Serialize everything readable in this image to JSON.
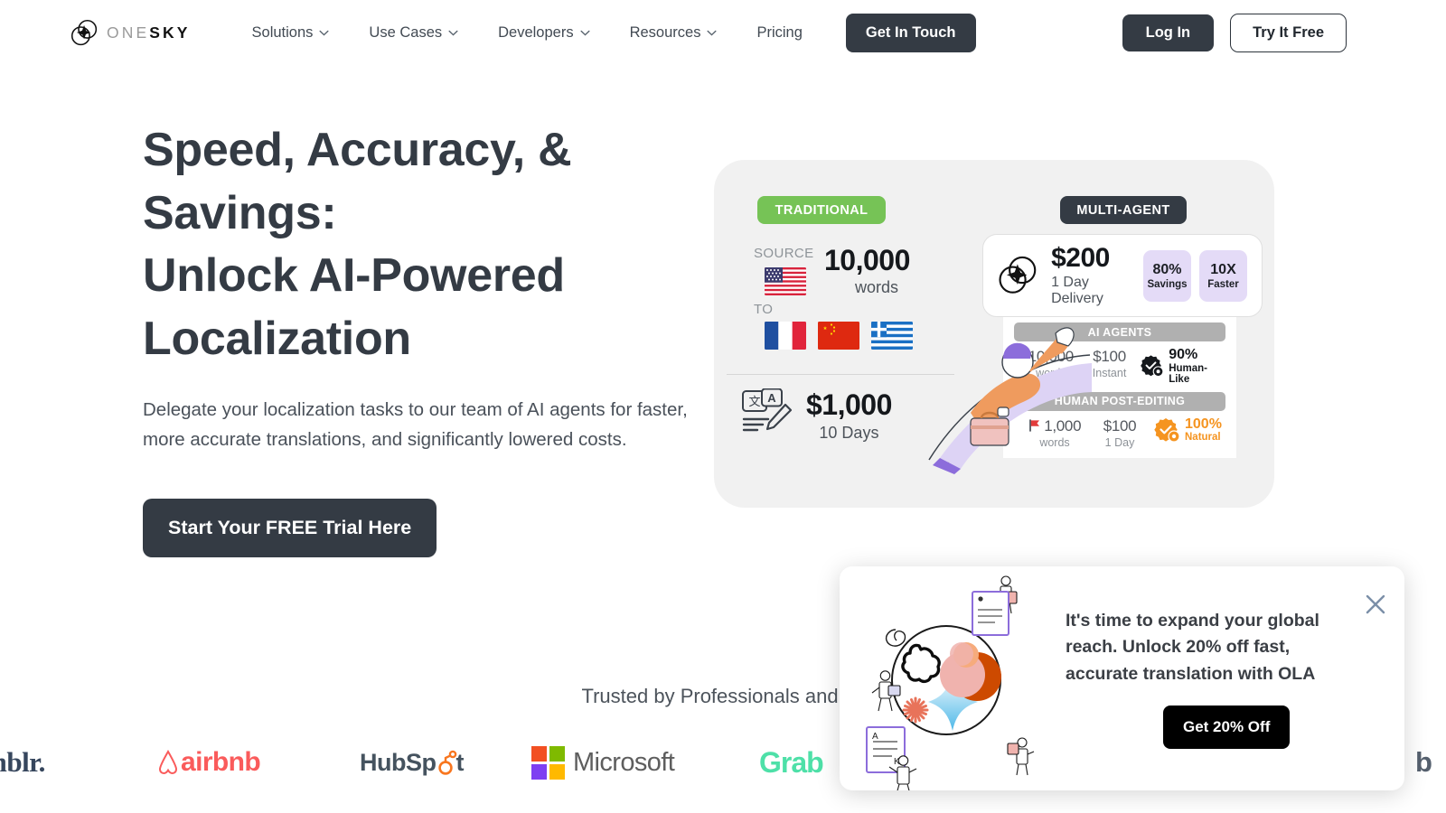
{
  "header": {
    "logo": {
      "part1": "ONE",
      "part2": "SKY",
      "icon": "onesky-logo-mark"
    },
    "nav": [
      {
        "label": "Solutions",
        "has_dropdown": true
      },
      {
        "label": "Use Cases",
        "has_dropdown": true
      },
      {
        "label": "Developers",
        "has_dropdown": true
      },
      {
        "label": "Resources",
        "has_dropdown": true
      },
      {
        "label": "Pricing",
        "has_dropdown": false
      }
    ],
    "get_in_touch": "Get In Touch",
    "log_in": "Log In",
    "try_it_free": "Try It Free"
  },
  "hero": {
    "title_line1": "Speed, Accuracy, &",
    "title_line2": "Savings:",
    "title_line3": "Unlock AI-Powered",
    "title_line4": "Localization",
    "subtitle": "Delegate your localization tasks to our team of AI agents for faster, more accurate translations, and significantly lowered costs.",
    "cta": "Start Your FREE Trial Here"
  },
  "infographic": {
    "traditional": {
      "badge": "TRADITIONAL",
      "badge_color": "#76c356",
      "source_label": "SOURCE",
      "to_label": "TO",
      "source_flag": "us-flag-icon",
      "target_flags": [
        "fr-flag-icon",
        "cn-flag-icon",
        "gr-flag-icon"
      ],
      "word_count": "10,000",
      "word_unit": "words",
      "cost": "$1,000",
      "duration": "10 Days",
      "cost_icon": "translate-document-icon"
    },
    "multi_agent": {
      "badge": "MULTI-AGENT",
      "badge_color": "#343b44",
      "logo_icon": "onesky-logo-mark",
      "price": "$200",
      "delivery": "1 Day Delivery",
      "badges": [
        {
          "value": "80%",
          "label": "Savings"
        },
        {
          "value": "10X",
          "label": "Faster"
        }
      ],
      "rows": [
        {
          "title": "AI AGENTS",
          "words": "10,000",
          "words_label": "words",
          "cost": "$100",
          "cost_label": "Instant",
          "quality": "90%",
          "quality_label": "Human-Like",
          "quality_icon": "verified-badge-dark-icon",
          "quality_color": "#15181c",
          "flag_icon": null
        },
        {
          "title": "HUMAN POST-EDITING",
          "words": "1,000",
          "words_label": "words",
          "cost": "$100",
          "cost_label": "1 Day",
          "quality": "100%",
          "quality_label": "Natural",
          "quality_icon": "verified-badge-orange-icon",
          "quality_color": "#f59420",
          "flag_icon": "red-flag-icon"
        }
      ]
    }
  },
  "trusted": {
    "heading": "Trusted by Professionals and Te",
    "logos": [
      {
        "name": "tumblr",
        "text": "mblr."
      },
      {
        "name": "airbnb",
        "text": "airbnb"
      },
      {
        "name": "hubspot",
        "text": "HubSp"
      },
      {
        "name": "microsoft",
        "text": "Microsoft"
      },
      {
        "name": "grab",
        "text": "Grab"
      },
      {
        "name": "partial-logo-right",
        "text": "b"
      }
    ]
  },
  "popup": {
    "message": "It's time to expand your global reach. Unlock 20% off fast, accurate translation with OLA",
    "cta": "Get 20% Off",
    "close_icon": "close-icon",
    "close_color": "#7b8fa8",
    "illustration": "ai-agents-globe-illustration"
  }
}
